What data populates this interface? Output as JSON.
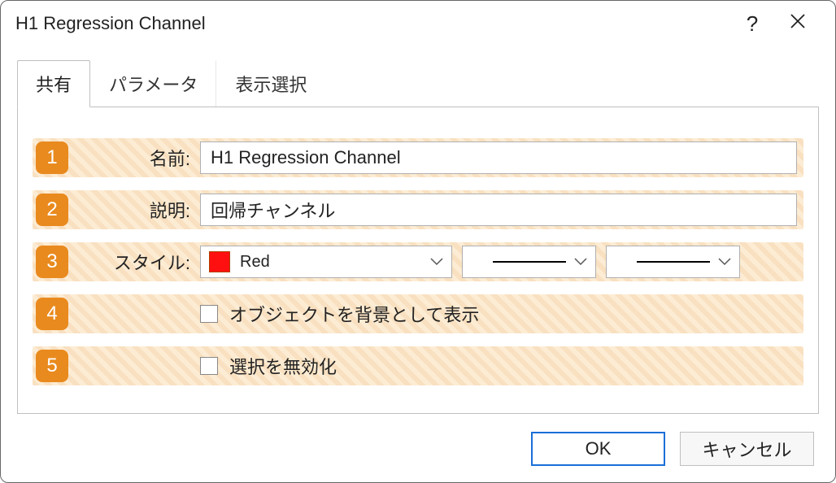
{
  "window": {
    "title": "H1 Regression Channel"
  },
  "tabs": {
    "t0": "共有",
    "t1": "パラメータ",
    "t2": "表示選択"
  },
  "badges": {
    "b1": "1",
    "b2": "2",
    "b3": "3",
    "b4": "4",
    "b5": "5"
  },
  "labels": {
    "name": "名前:",
    "desc": "説明:",
    "style": "スタイル:"
  },
  "values": {
    "name": "H1 Regression Channel",
    "desc": "回帰チャンネル",
    "color_name": "Red",
    "color_hex": "#ff1010"
  },
  "checks": {
    "bg": "オブジェクトを背景として表示",
    "disable_sel": "選択を無効化"
  },
  "buttons": {
    "ok": "OK",
    "cancel": "キャンセル"
  }
}
